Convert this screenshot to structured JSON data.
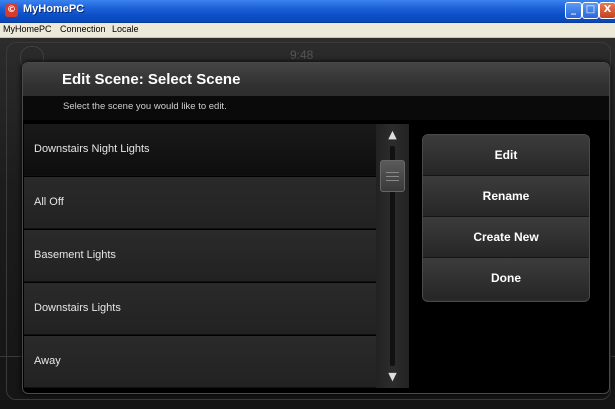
{
  "window": {
    "title": "MyHomePC",
    "icon": "app-logo-icon",
    "controls": {
      "minimize": "_",
      "maximize": "□",
      "close": "X"
    }
  },
  "menubar": {
    "items": [
      "MyHomePC",
      "Connection",
      "Locale"
    ]
  },
  "background": {
    "clock": "9:48"
  },
  "dialog": {
    "title": "Edit Scene: Select Scene",
    "subtitle": "Select the scene you would like to edit.",
    "scenes": [
      {
        "label": "Downstairs Night Lights",
        "selected": true
      },
      {
        "label": "All Off",
        "selected": false
      },
      {
        "label": "Basement Lights",
        "selected": false
      },
      {
        "label": "Downstairs Lights",
        "selected": false
      },
      {
        "label": "Away",
        "selected": false
      }
    ],
    "scrollbar": {
      "up": "▲",
      "down": "▼"
    },
    "actions": {
      "edit": "Edit",
      "rename": "Rename",
      "create_new": "Create New",
      "done": "Done"
    }
  }
}
